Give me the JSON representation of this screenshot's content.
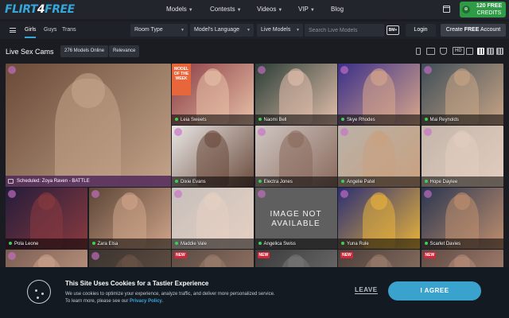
{
  "brand": {
    "logo_a": "FLIRT",
    "logo_b": "4",
    "logo_c": "FREE",
    "accent": "#35a7d9"
  },
  "nav": {
    "items": [
      {
        "label": "Models",
        "has_menu": true
      },
      {
        "label": "Contests",
        "has_menu": true
      },
      {
        "label": "Videos",
        "has_menu": true
      },
      {
        "label": "VIP",
        "has_menu": true
      },
      {
        "label": "Blog",
        "has_menu": false
      }
    ],
    "calendar_icon": "calendar-icon"
  },
  "credits": {
    "amount": "120",
    "free": "FREE",
    "word": "CREDITS",
    "icon": "credits-icon",
    "color": "#2f9b47"
  },
  "filter": {
    "tabs": [
      {
        "label": "Girls",
        "active": true
      },
      {
        "label": "Guys",
        "active": false
      },
      {
        "label": "Trans",
        "active": false
      }
    ],
    "selects": [
      "Room Type",
      "Model's Language",
      "Live Models"
    ],
    "search_placeholder": "Search Live Models",
    "bm_label": "BM+",
    "login_label": "Login",
    "create_prefix": "Create ",
    "create_bold": "FREE",
    "create_suffix": " Account"
  },
  "title_bar": {
    "title": "Live Sex Cams",
    "online_count": "276 Models Online",
    "sort": "Relevance",
    "view_icons": [
      "mobile-icon",
      "desktop-icon",
      "filter-icon",
      "hd-icon",
      "list-view-icon",
      "grid-small-icon",
      "grid-medium-icon",
      "grid-large-icon"
    ],
    "hd_label": "HD"
  },
  "tiles": [
    {
      "name": "Scheduled: Zoya Raven - BATTLE",
      "status": "scheduled",
      "colors": [
        "#6a4a38",
        "#c4a58a"
      ]
    },
    {
      "name": "Leia Sweets",
      "status": "online",
      "colors": [
        "#8a3b43",
        "#e8c1a8"
      ],
      "ribbon": "MODEL OF THE WEEK"
    },
    {
      "name": "Naomi Bell",
      "status": "online",
      "colors": [
        "#2a3d36",
        "#e4c0ad"
      ]
    },
    {
      "name": "Skye Rhodes",
      "status": "online",
      "colors": [
        "#3a2f89",
        "#d9a78b"
      ]
    },
    {
      "name": "Mai Reynolds",
      "status": "online",
      "colors": [
        "#3f4d57",
        "#c9a586"
      ]
    },
    {
      "name": "Dixie Evans",
      "status": "online",
      "colors": [
        "#e9e7e5",
        "#6b4a3c"
      ]
    },
    {
      "name": "Electra Jones",
      "status": "online",
      "colors": [
        "#cfc7c3",
        "#8a6a5c"
      ]
    },
    {
      "name": "Angelie Patel",
      "status": "online",
      "colors": [
        "#b9b2a8",
        "#c9a07f"
      ]
    },
    {
      "name": "Hope Daylee",
      "status": "online",
      "colors": [
        "#c4b5aa",
        "#e2cdbf"
      ]
    },
    {
      "name": "Pola Leone",
      "status": "online",
      "colors": [
        "#241c3a",
        "#8a3a3f"
      ]
    },
    {
      "name": "Zara Elsa",
      "status": "online",
      "colors": [
        "#5c4537",
        "#d0a58a"
      ]
    },
    {
      "name": "Maddie Vale",
      "status": "online",
      "colors": [
        "#c7c0bb",
        "#e6d0c2"
      ]
    },
    {
      "name": "Angelica Swiss",
      "status": "online",
      "not_available": "IMAGE NOT AVAILABLE",
      "colors": [
        "#5f5f5f",
        "#5f5f5f"
      ]
    },
    {
      "name": "Yuna Rule",
      "status": "online",
      "colors": [
        "#2c2f74",
        "#e8b33a"
      ]
    },
    {
      "name": "Scarlet Davies",
      "status": "online",
      "colors": [
        "#2a3650",
        "#c08f6e"
      ]
    },
    {
      "name": "",
      "status": "offline",
      "colors": [
        "#7a5d52",
        "#caa18a"
      ]
    },
    {
      "name": "",
      "status": "offline",
      "colors": [
        "#3a342f",
        "#6b5447"
      ]
    },
    {
      "name": "",
      "status": "offline",
      "new_badge": "NEW",
      "colors": [
        "#5a4a42",
        "#9d7d6c"
      ]
    },
    {
      "name": "",
      "status": "offline",
      "new_badge": "NEW",
      "colors": [
        "#3a3a3a",
        "#777"
      ]
    },
    {
      "name": "",
      "status": "offline",
      "new_badge": "NEW",
      "colors": [
        "#4a3f3a",
        "#9a7b6b"
      ]
    },
    {
      "name": "",
      "status": "offline",
      "new_badge": "NEW",
      "colors": [
        "#5e4a44",
        "#b58c78"
      ]
    }
  ],
  "status_colors": {
    "online": "#3ccf5a",
    "scheduled": "#e35d9d",
    "offline": "#3ccf5a"
  },
  "cookie": {
    "title": "This Site Uses Cookies for a Tastier Experience",
    "line1": "We use cookies to optimize your experience, analyze traffic, and deliver more personalized service.",
    "line2_prefix": "To learn more, please see our ",
    "policy_link": "Privacy Policy",
    "line2_suffix": ".",
    "leave_label": "LEAVE",
    "agree_label": "I AGREE",
    "icon": "cookie-icon"
  }
}
